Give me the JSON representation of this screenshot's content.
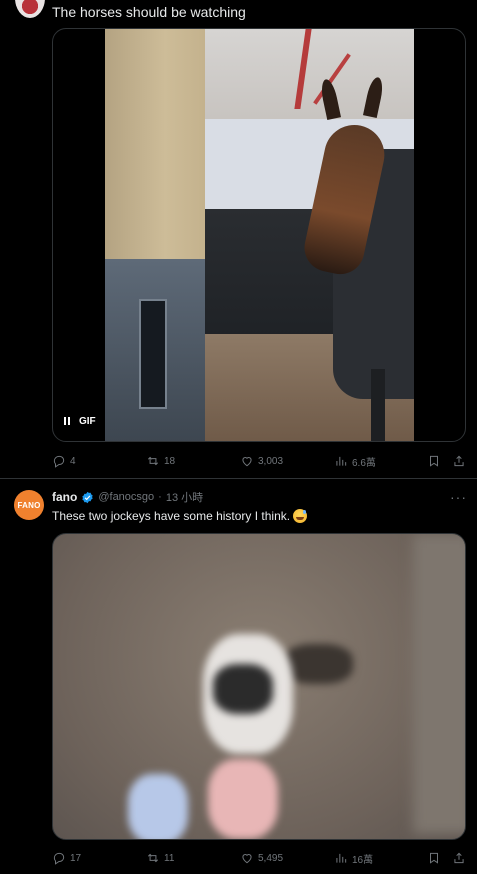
{
  "tweet1": {
    "text": "The horses should be watching",
    "media": {
      "badge": "GIF"
    },
    "actions": {
      "replies": "4",
      "retweets": "18",
      "likes": "3,003",
      "views": "6.6萬"
    }
  },
  "tweet2": {
    "avatar_text": "FANO",
    "author": "fano",
    "handle": "@fanocsgo",
    "separator": "·",
    "time": "13 小時",
    "text": "These two jockeys have some history I think.",
    "actions": {
      "replies": "17",
      "retweets": "11",
      "likes": "5,495",
      "views": "16萬"
    }
  },
  "colors": {
    "background": "#000000",
    "text": "#e7e9ea",
    "muted": "#71767b",
    "verified": "#1d9bf0",
    "fano_brand": "#f0812e"
  },
  "icons": [
    "pause-icon",
    "reply-icon",
    "retweet-icon",
    "like-icon",
    "views-icon",
    "bookmark-icon",
    "share-icon",
    "verified-icon",
    "more-icon"
  ]
}
